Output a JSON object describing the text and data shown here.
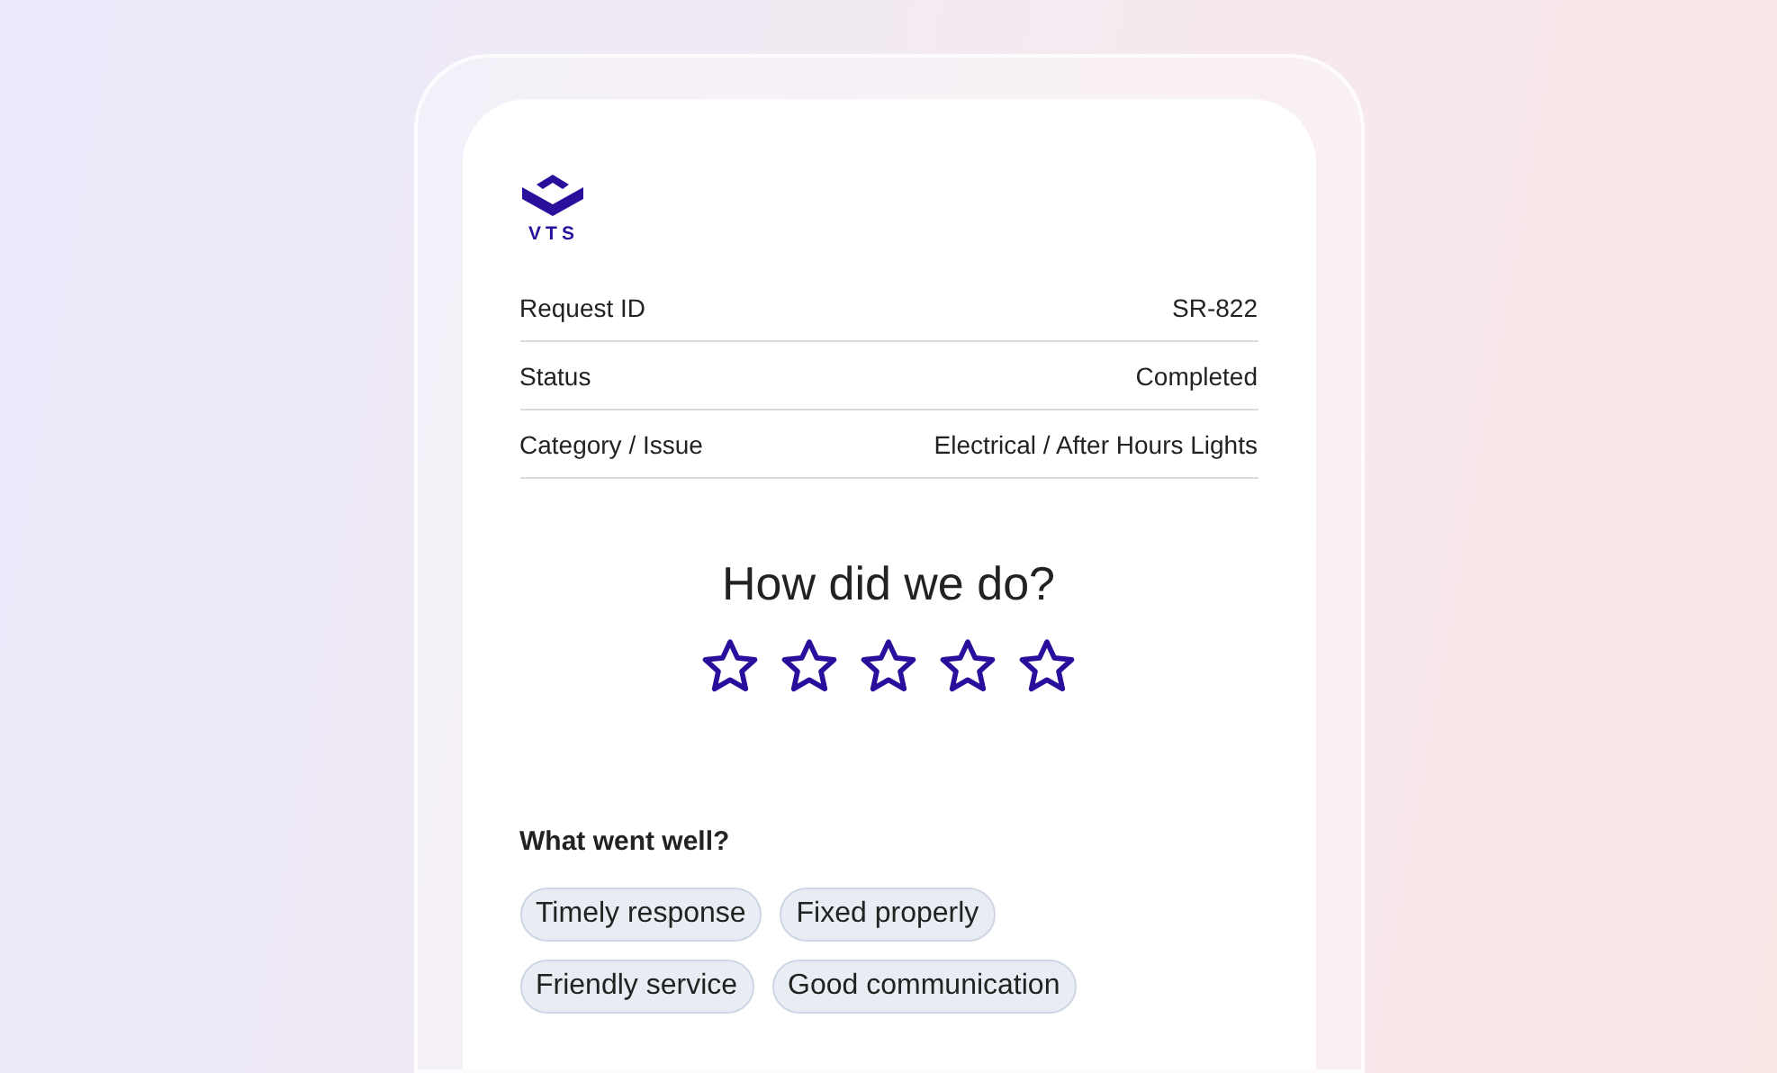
{
  "logo": {
    "text": "VTS"
  },
  "details": [
    {
      "label": "Request ID",
      "value": "SR-822"
    },
    {
      "label": "Status",
      "value": "Completed"
    },
    {
      "label": "Category / Issue",
      "value": "Electrical / After Hours Lights"
    }
  ],
  "rating": {
    "question": "How did we do?",
    "stars": 0
  },
  "feedback": {
    "heading": "What went well?",
    "tags": [
      {
        "label": "Timely response",
        "selected": false
      },
      {
        "label": "Fixed properly",
        "selected": false
      },
      {
        "label": "Friendly service",
        "selected": false
      },
      {
        "label": "Good communication",
        "selected": false
      }
    ]
  }
}
